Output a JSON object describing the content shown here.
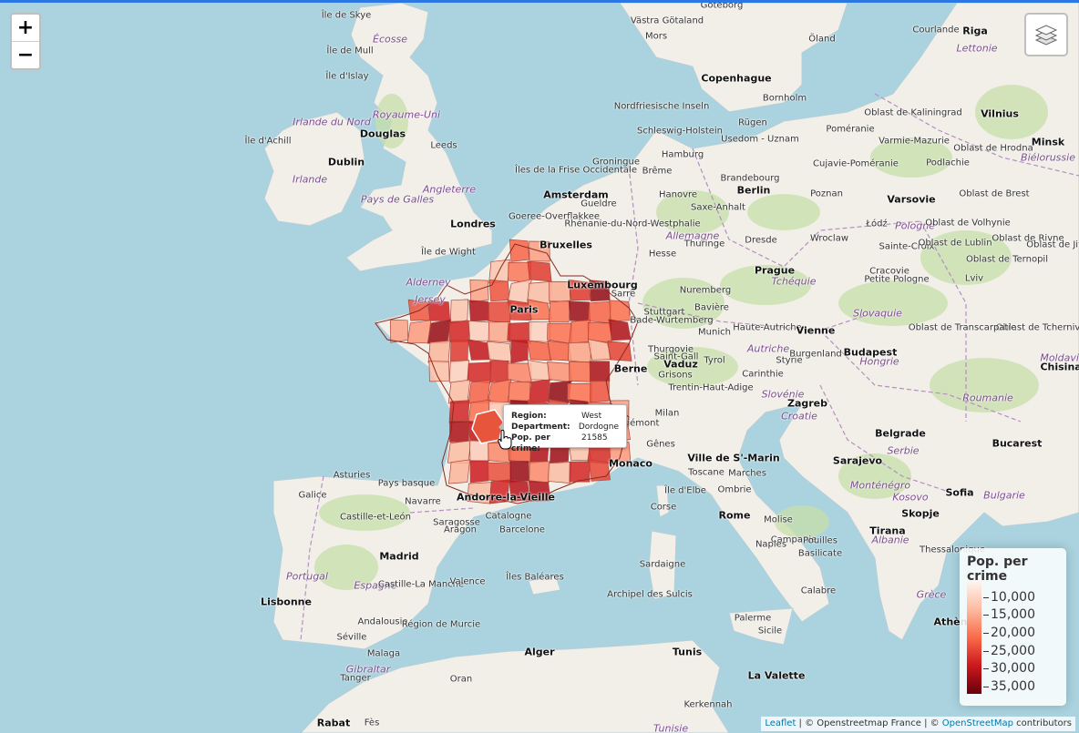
{
  "map": {
    "zoom_in_label": "+",
    "zoom_out_label": "−",
    "layers_control": "layers-icon",
    "place_labels": [
      {
        "text": "Île de Skye",
        "kind": "minor"
      },
      {
        "text": "Écosse",
        "kind": "country"
      },
      {
        "text": "Île de Mull",
        "kind": "minor"
      },
      {
        "text": "Île d'Islay",
        "kind": "minor"
      },
      {
        "text": "Royaume-Uni",
        "kind": "country"
      },
      {
        "text": "Irlande du Nord",
        "kind": "country"
      },
      {
        "text": "Douglas",
        "kind": "city"
      },
      {
        "text": "Île d'Achill",
        "kind": "minor"
      },
      {
        "text": "Dublin",
        "kind": "city"
      },
      {
        "text": "Irlande",
        "kind": "country"
      },
      {
        "text": "Leeds",
        "kind": "minor"
      },
      {
        "text": "Angleterre",
        "kind": "country"
      },
      {
        "text": "Pays de Galles",
        "kind": "country"
      },
      {
        "text": "Londres",
        "kind": "city"
      },
      {
        "text": "Île de Wight",
        "kind": "minor"
      },
      {
        "text": "Jersey",
        "kind": "country"
      },
      {
        "text": "Alderney",
        "kind": "country"
      },
      {
        "text": "Göteborg",
        "kind": "minor"
      },
      {
        "text": "Västra Götaland",
        "kind": "minor"
      },
      {
        "text": "Mors",
        "kind": "minor"
      },
      {
        "text": "Öland",
        "kind": "minor"
      },
      {
        "text": "Copenhague",
        "kind": "city"
      },
      {
        "text": "Bornholm",
        "kind": "minor"
      },
      {
        "text": "Nordfriesische Inseln",
        "kind": "minor"
      },
      {
        "text": "Schleswig-Holstein",
        "kind": "minor"
      },
      {
        "text": "Rügen",
        "kind": "minor"
      },
      {
        "text": "Usedom - Uznam",
        "kind": "minor"
      },
      {
        "text": "Hamburg",
        "kind": "minor"
      },
      {
        "text": "Îles de la Frise Occidentale",
        "kind": "minor"
      },
      {
        "text": "Groningue",
        "kind": "minor"
      },
      {
        "text": "Brême",
        "kind": "minor"
      },
      {
        "text": "Amsterdam",
        "kind": "city"
      },
      {
        "text": "Hanovre",
        "kind": "minor"
      },
      {
        "text": "Berlin",
        "kind": "city"
      },
      {
        "text": "Brandebourg",
        "kind": "minor"
      },
      {
        "text": "Poznan",
        "kind": "minor"
      },
      {
        "text": "Goeree-Overflakkee",
        "kind": "minor"
      },
      {
        "text": "Gueldre",
        "kind": "minor"
      },
      {
        "text": "Rhénanie-du-Nord-Westphalie",
        "kind": "minor"
      },
      {
        "text": "Allemagne",
        "kind": "country"
      },
      {
        "text": "Saxe-Anhalt",
        "kind": "minor"
      },
      {
        "text": "Thuringe",
        "kind": "minor"
      },
      {
        "text": "Dresde",
        "kind": "minor"
      },
      {
        "text": "Wroclaw",
        "kind": "minor"
      },
      {
        "text": "Bruxelles",
        "kind": "city"
      },
      {
        "text": "Hesse",
        "kind": "minor"
      },
      {
        "text": "Luxembourg",
        "kind": "city"
      },
      {
        "text": "Sarre",
        "kind": "minor"
      },
      {
        "text": "Nuremberg",
        "kind": "minor"
      },
      {
        "text": "Prague",
        "kind": "city"
      },
      {
        "text": "Tchéquie",
        "kind": "country"
      },
      {
        "text": "Paris",
        "kind": "city"
      },
      {
        "text": "Stuttgart",
        "kind": "minor"
      },
      {
        "text": "Bade-Wurtemberg",
        "kind": "minor"
      },
      {
        "text": "Bavière",
        "kind": "minor"
      },
      {
        "text": "Munich",
        "kind": "minor"
      },
      {
        "text": "Haute-Autriche",
        "kind": "minor"
      },
      {
        "text": "Vienne",
        "kind": "city"
      },
      {
        "text": "Autriche",
        "kind": "country"
      },
      {
        "text": "Berne",
        "kind": "city"
      },
      {
        "text": "Vaduz",
        "kind": "city"
      },
      {
        "text": "Thurgovie",
        "kind": "minor"
      },
      {
        "text": "Saint-Gall",
        "kind": "minor"
      },
      {
        "text": "Tyrol",
        "kind": "minor"
      },
      {
        "text": "Grisons",
        "kind": "minor"
      },
      {
        "text": "Trentin-Haut-Adige",
        "kind": "minor"
      },
      {
        "text": "Carinthie",
        "kind": "minor"
      },
      {
        "text": "Styrie",
        "kind": "minor"
      },
      {
        "text": "Burgenland",
        "kind": "minor"
      },
      {
        "text": "Slovénie",
        "kind": "country"
      },
      {
        "text": "Zagreb",
        "kind": "city"
      },
      {
        "text": "Croatie",
        "kind": "country"
      },
      {
        "text": "Milan",
        "kind": "minor"
      },
      {
        "text": "Piémont",
        "kind": "minor"
      },
      {
        "text": "Gênes",
        "kind": "minor"
      },
      {
        "text": "Monaco",
        "kind": "city"
      },
      {
        "text": "Ville de S'-Marin",
        "kind": "city"
      },
      {
        "text": "Toscane",
        "kind": "minor"
      },
      {
        "text": "Marches",
        "kind": "minor"
      },
      {
        "text": "Ombrie",
        "kind": "minor"
      },
      {
        "text": "Île d'Elbe",
        "kind": "minor"
      },
      {
        "text": "Rome",
        "kind": "city"
      },
      {
        "text": "Molise",
        "kind": "minor"
      },
      {
        "text": "Corse",
        "kind": "minor"
      },
      {
        "text": "Campanie",
        "kind": "minor"
      },
      {
        "text": "Naples",
        "kind": "minor"
      },
      {
        "text": "Pouilles",
        "kind": "minor"
      },
      {
        "text": "Basilicate",
        "kind": "minor"
      },
      {
        "text": "Sardaigne",
        "kind": "minor"
      },
      {
        "text": "Calabre",
        "kind": "minor"
      },
      {
        "text": "Archipel des Sulcis",
        "kind": "minor"
      },
      {
        "text": "Palerme",
        "kind": "minor"
      },
      {
        "text": "Sicile",
        "kind": "minor"
      },
      {
        "text": "La Valette",
        "kind": "city"
      },
      {
        "text": "Tunis",
        "kind": "city"
      },
      {
        "text": "Alger",
        "kind": "city"
      },
      {
        "text": "Kerkennah",
        "kind": "minor"
      },
      {
        "text": "Tunisie",
        "kind": "country"
      },
      {
        "text": "Rabat",
        "kind": "city"
      },
      {
        "text": "Fès",
        "kind": "minor"
      },
      {
        "text": "Oran",
        "kind": "minor"
      },
      {
        "text": "Tanger",
        "kind": "minor"
      },
      {
        "text": "Gibraltar",
        "kind": "country"
      },
      {
        "text": "Malaga",
        "kind": "minor"
      },
      {
        "text": "Séville",
        "kind": "minor"
      },
      {
        "text": "Andalousie",
        "kind": "minor"
      },
      {
        "text": "Lisbonne",
        "kind": "city"
      },
      {
        "text": "Portugal",
        "kind": "country"
      },
      {
        "text": "Espagne",
        "kind": "country"
      },
      {
        "text": "Madrid",
        "kind": "city"
      },
      {
        "text": "Castille-La Manche",
        "kind": "minor"
      },
      {
        "text": "Valence",
        "kind": "minor"
      },
      {
        "text": "Région de Murcie",
        "kind": "minor"
      },
      {
        "text": "Îles Baléares",
        "kind": "minor"
      },
      {
        "text": "Castille-et-León",
        "kind": "minor"
      },
      {
        "text": "Galice",
        "kind": "minor"
      },
      {
        "text": "Asturies",
        "kind": "minor"
      },
      {
        "text": "Pays basque",
        "kind": "minor"
      },
      {
        "text": "Navarre",
        "kind": "minor"
      },
      {
        "text": "Saragosse",
        "kind": "minor"
      },
      {
        "text": "Aragon",
        "kind": "minor"
      },
      {
        "text": "Catalogne",
        "kind": "minor"
      },
      {
        "text": "Barcelone",
        "kind": "minor"
      },
      {
        "text": "Andorre-la-Vieille",
        "kind": "city"
      },
      {
        "text": "Riga",
        "kind": "city"
      },
      {
        "text": "Lettonie",
        "kind": "country"
      },
      {
        "text": "Courlande",
        "kind": "minor"
      },
      {
        "text": "Vilnius",
        "kind": "city"
      },
      {
        "text": "Minsk",
        "kind": "city"
      },
      {
        "text": "Biélorussie",
        "kind": "country"
      },
      {
        "text": "Oblast de Kaliningrad",
        "kind": "minor"
      },
      {
        "text": "Poméranie",
        "kind": "minor"
      },
      {
        "text": "Varmie-Mazurie",
        "kind": "minor"
      },
      {
        "text": "Cujavie-Poméranie",
        "kind": "minor"
      },
      {
        "text": "Podlachie",
        "kind": "minor"
      },
      {
        "text": "Oblast de Hrodna",
        "kind": "minor"
      },
      {
        "text": "Oblast de Brest",
        "kind": "minor"
      },
      {
        "text": "Varsovie",
        "kind": "city"
      },
      {
        "text": "Pologne",
        "kind": "country"
      },
      {
        "text": "Łódź",
        "kind": "minor"
      },
      {
        "text": "Oblast de Volhynie",
        "kind": "minor"
      },
      {
        "text": "Oblast de Rivne",
        "kind": "minor"
      },
      {
        "text": "Oblast de Jitomir",
        "kind": "minor"
      },
      {
        "text": "Sainte-Croix",
        "kind": "minor"
      },
      {
        "text": "Oblast de Lublin",
        "kind": "minor"
      },
      {
        "text": "Cracovie",
        "kind": "minor"
      },
      {
        "text": "Petite Pologne",
        "kind": "minor"
      },
      {
        "text": "Lviv",
        "kind": "minor"
      },
      {
        "text": "Oblast de Ternopil",
        "kind": "minor"
      },
      {
        "text": "Slovaquie",
        "kind": "country"
      },
      {
        "text": "Oblast de Tchernivtsi",
        "kind": "minor"
      },
      {
        "text": "Oblast de Transcarpatie",
        "kind": "minor"
      },
      {
        "text": "Budapest",
        "kind": "city"
      },
      {
        "text": "Hongrie",
        "kind": "country"
      },
      {
        "text": "Moldavie",
        "kind": "country"
      },
      {
        "text": "Chisinau",
        "kind": "city"
      },
      {
        "text": "Roumanie",
        "kind": "country"
      },
      {
        "text": "Bucarest",
        "kind": "city"
      },
      {
        "text": "Belgrade",
        "kind": "city"
      },
      {
        "text": "Serbie",
        "kind": "country"
      },
      {
        "text": "Sarajevo",
        "kind": "city"
      },
      {
        "text": "Monténégro",
        "kind": "country"
      },
      {
        "text": "Kosovo",
        "kind": "country"
      },
      {
        "text": "Bulgarie",
        "kind": "country"
      },
      {
        "text": "Sofia",
        "kind": "city"
      },
      {
        "text": "Skopje",
        "kind": "city"
      },
      {
        "text": "Tirana",
        "kind": "city"
      },
      {
        "text": "Albanie",
        "kind": "country"
      },
      {
        "text": "Thessalonique",
        "kind": "minor"
      },
      {
        "text": "Grèce",
        "kind": "country"
      },
      {
        "text": "Athènes",
        "kind": "city"
      }
    ],
    "colors": {
      "water": "#aad3df",
      "land": "#f2efe9",
      "forest": "#c7dfa9",
      "border": "#b48fc0"
    }
  },
  "tooltip": {
    "rows": [
      {
        "key": "Region:",
        "value": "West"
      },
      {
        "key": "Department:",
        "value": "Dordogne"
      },
      {
        "key": "Pop. per crime:",
        "value": "21585"
      }
    ]
  },
  "legend": {
    "title": "Pop. per crime",
    "ticks": [
      {
        "value": 10000,
        "label": "10,000"
      },
      {
        "value": 15000,
        "label": "15,000"
      },
      {
        "value": 20000,
        "label": "20,000"
      },
      {
        "value": 25000,
        "label": "25,000"
      },
      {
        "value": 30000,
        "label": "30,000"
      },
      {
        "value": 35000,
        "label": "35,000"
      }
    ],
    "range": [
      5500,
      37000
    ],
    "colors": [
      "#fff5f0",
      "#fcbba1",
      "#fb6a4a",
      "#cb181d",
      "#67000d"
    ]
  },
  "attribution": {
    "leaflet": "Leaflet",
    "text1": " | © Openstreetmap France | © ",
    "osm": "OpenStreetMap",
    "text2": " contributors"
  }
}
